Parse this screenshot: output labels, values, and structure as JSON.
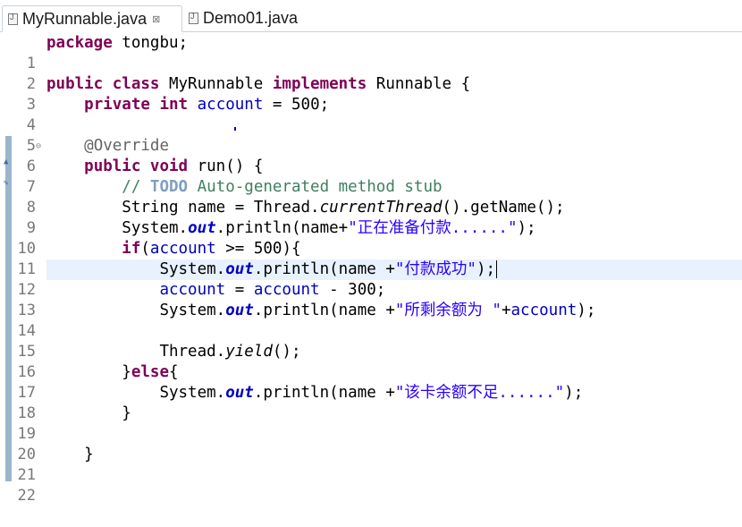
{
  "tabs": [
    {
      "label": "MyRunnable.java",
      "active": true,
      "close": "⊠"
    },
    {
      "label": "Demo01.java",
      "active": false
    }
  ],
  "gutter": {
    "line_numbers": [
      "1",
      "2",
      "3",
      "4",
      "5",
      "6",
      "7",
      "8",
      "9",
      "10",
      "11",
      "12",
      "13",
      "14",
      "15",
      "16",
      "17",
      "18",
      "19",
      "20",
      "21",
      "22"
    ],
    "fold_markers": {
      "6": "⊖"
    }
  },
  "code": {
    "l1": {
      "kw": "package",
      "rest": " tongbu;"
    },
    "l3": {
      "kw1": "public",
      "kw2": "class",
      "name": " MyRunnable ",
      "kw3": "implements",
      "rest": " Runnable {"
    },
    "l4": {
      "kw1": "private",
      "kw2": "int",
      "field": "account",
      "rest": " = 500;"
    },
    "l6": {
      "ann": "@Override"
    },
    "l7": {
      "kw1": "public",
      "kw2": "void",
      "rest": " run() {"
    },
    "l8": {
      "c1": "// ",
      "todo": "TODO",
      "c2": " Auto-generated method stub"
    },
    "l9": {
      "a": "String ",
      "var": "name",
      "b": " = Thread.",
      "it": "currentThread",
      "c": "().getName();"
    },
    "l10": {
      "a": "System.",
      "st": "out",
      "b": ".println(name+",
      "str": "\"正在准备付款......\"",
      "c": ");"
    },
    "l11": {
      "kw": "if",
      "a": "(",
      "field": "account",
      "b": " >= 500){"
    },
    "l12": {
      "a": "System.",
      "st": "out",
      "b": ".println(name +",
      "str": "\"付款成功\"",
      "c": ");"
    },
    "l13": {
      "f1": "account",
      "a": " = ",
      "f2": "account",
      "b": " - 300;"
    },
    "l14": {
      "a": "System.",
      "st": "out",
      "b": ".println(name +",
      "str": "\"所剩余额为 \"",
      "c": "+",
      "field": "account",
      "d": ");"
    },
    "l16": {
      "a": "Thread.",
      "it": "yield",
      "b": "();"
    },
    "l17": {
      "a": "}",
      "kw": "else",
      "b": "{"
    },
    "l18": {
      "a": "System.",
      "st": "out",
      "b": ".println(name +",
      "str": "\"该卡余额不足......\"",
      "c": ");"
    },
    "l19": {
      "a": "}"
    },
    "l21": {
      "a": "}"
    }
  },
  "colors": {
    "keyword": "#7f0055",
    "field": "#0000c0",
    "string": "#2a00ff",
    "comment": "#3f7f5f",
    "current_line": "#e8f2fe"
  }
}
